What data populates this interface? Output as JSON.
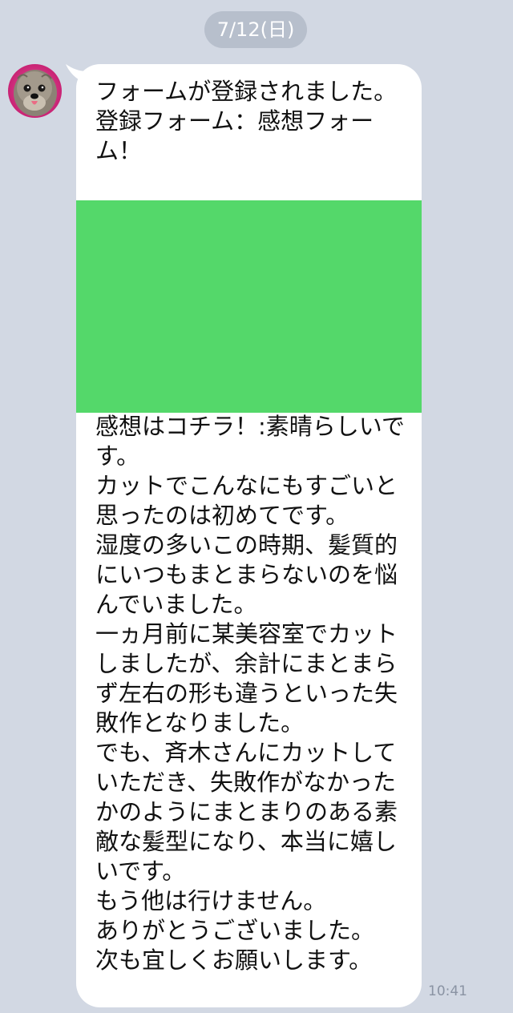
{
  "chat": {
    "date_label": "7/12(日)",
    "message": {
      "header_text": "フォームが登録されました。\n登録フォーム：感想フォーム！",
      "body_text": "感想はコチラ！:素晴らしいです。\nカットでこんなにもすごいと思ったのは初めてです。\n湿度の多いこの時期、髪質的にいつもまとまらないのを悩んでいました。\n一ヵ月前に某美容室でカットしましたが、余計にまとまらず左右の形も違うといった失敗作となりました。\nでも、斉木さんにカットしていただき、失敗作がなかったかのようにまとまりのある素敵な髪型になり、本当に嬉しいです。\nもう他は行けません。\nありがとうございました。\n次も宜しくお願いします。",
      "time": "10:41"
    },
    "sender_avatar": "dog-avatar-icon"
  },
  "colors": {
    "background": "#d2d8e3",
    "bubble": "#ffffff",
    "date_pill": "#b7bfcc",
    "image_block": "#54d86a",
    "timestamp": "#8a93a3"
  }
}
